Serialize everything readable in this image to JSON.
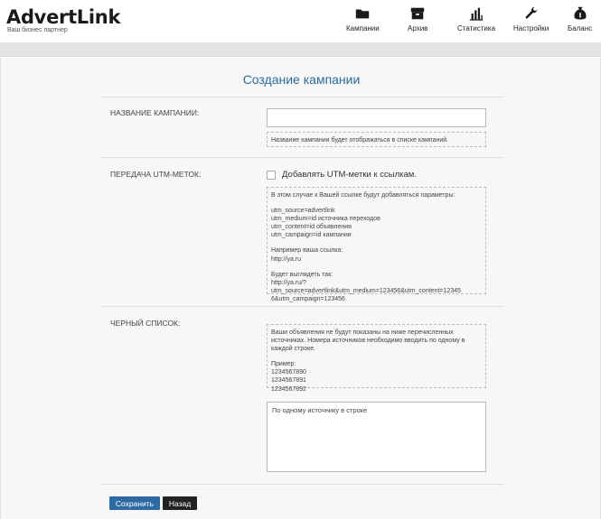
{
  "header": {
    "logo": "AdvertLink",
    "tagline": "Ваш бизнес партнер",
    "nav": [
      {
        "label": "Кампании",
        "icon": "folder-icon"
      },
      {
        "label": "Архив",
        "icon": "archive-icon"
      },
      {
        "label": "Статистика",
        "icon": "bar-chart-icon"
      },
      {
        "label": "Настройки",
        "icon": "wrench-icon"
      },
      {
        "label": "Баланс",
        "icon": "money-bag-icon"
      }
    ]
  },
  "main": {
    "title": "Создание кампании",
    "campaign_name": {
      "label": "НАЗВАНИЕ КАМПАНИИ:",
      "value": "",
      "hint": "Название кампании будет отображаться в списке кампаний."
    },
    "utm": {
      "label": "ПЕРЕДАЧА UTM-МЕТОК:",
      "checkbox_label": "Добавлять UTM-метки к ссылкам.",
      "hint_intro": "В этом случае к Вашей ссылке будут добавляться параметры:",
      "hint_params": [
        "utm_source=advertlink",
        "utm_medium=id источника переходов",
        "utm_content=id объявления",
        "utm_campaign=id кампании"
      ],
      "hint_example_label": "Например ваша ссылка:",
      "hint_example_url": "http://ya.ru",
      "hint_result_label": "Будет выглядеть так:",
      "hint_result_lines": [
        "http://ya.ru/?",
        "utm_source=advertlink&utm_medium=123456&utm_content=12345",
        "6&utm_campaign=123456"
      ]
    },
    "blacklist": {
      "label": "ЧЕРНЫЙ СПИСОК:",
      "hint_intro": "Ваши объявления не будут показаны на ниже перечисленных источниках. Номера источников необходимо вводить по одному в каждой строке.",
      "hint_example_label": "Пример:",
      "hint_example_lines": [
        "1234567890",
        "1234567891",
        "1234567892"
      ],
      "textarea_value": "По одному источнику в строке"
    },
    "buttons": {
      "save": "Сохранить",
      "back": "Назад"
    }
  },
  "colors": {
    "accent": "#2d6aa3",
    "title": "#2d6b9a",
    "back_button": "#222222"
  }
}
